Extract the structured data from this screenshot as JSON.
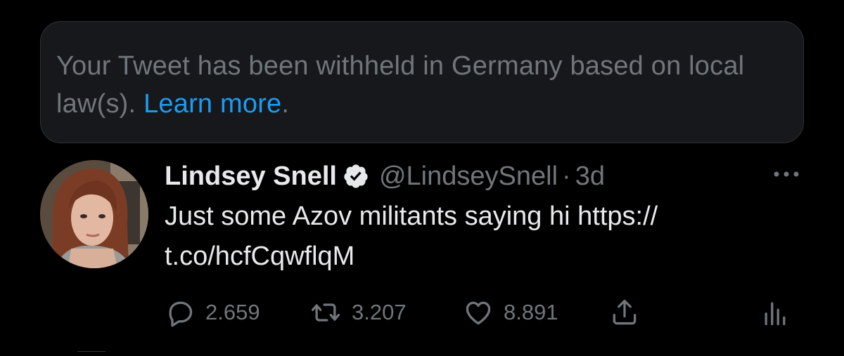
{
  "notice": {
    "text": "Your Tweet has been withheld in Germany based on local law(s).",
    "link_label": "Learn more",
    "suffix": "."
  },
  "tweet": {
    "display_name": "Lindsey Snell",
    "handle": "@LindseySnell",
    "separator": "·",
    "time": "3d",
    "text_line1": "Just some Azov militants saying hi https://",
    "text_line2": "t.co/hcfCqwflqM",
    "stats": {
      "replies": "2.659",
      "retweets": "3.207",
      "likes": "8.891"
    }
  },
  "icons": {
    "verified": "verified-badge-icon",
    "more": "more-options-icon",
    "reply": "reply-icon",
    "retweet": "retweet-icon",
    "like": "heart-icon",
    "share": "share-icon",
    "analytics": "analytics-icon"
  },
  "colors": {
    "background": "#000000",
    "notice_bg": "#16181c",
    "muted_text": "#71767b",
    "primary_text": "#e7e9ea",
    "link": "#1d9bf0"
  }
}
